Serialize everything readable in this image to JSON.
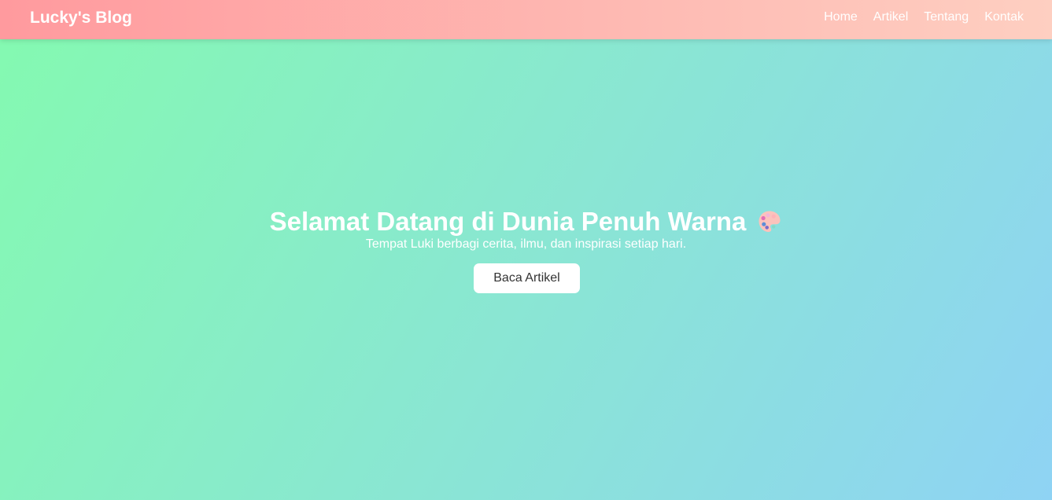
{
  "header": {
    "brand": "Lucky's Blog",
    "nav": [
      "Home",
      "Artikel",
      "Tentang",
      "Kontak"
    ]
  },
  "hero": {
    "title": "Selamat Datang di Dunia Penuh Warna",
    "title_icon": "palette-icon",
    "subtitle": "Tempat Luki berbagi cerita, ilmu, dan inspirasi setiap hari.",
    "button_label": "Baca Artikel"
  },
  "colors": {
    "header_gradient": [
      "#ff9a9e",
      "#fecfc1"
    ],
    "hero_gradient": [
      "#84fab0",
      "#8fd3f4"
    ],
    "text": "#ffffff",
    "button_bg": "#ffffff",
    "button_text": "#333333"
  }
}
